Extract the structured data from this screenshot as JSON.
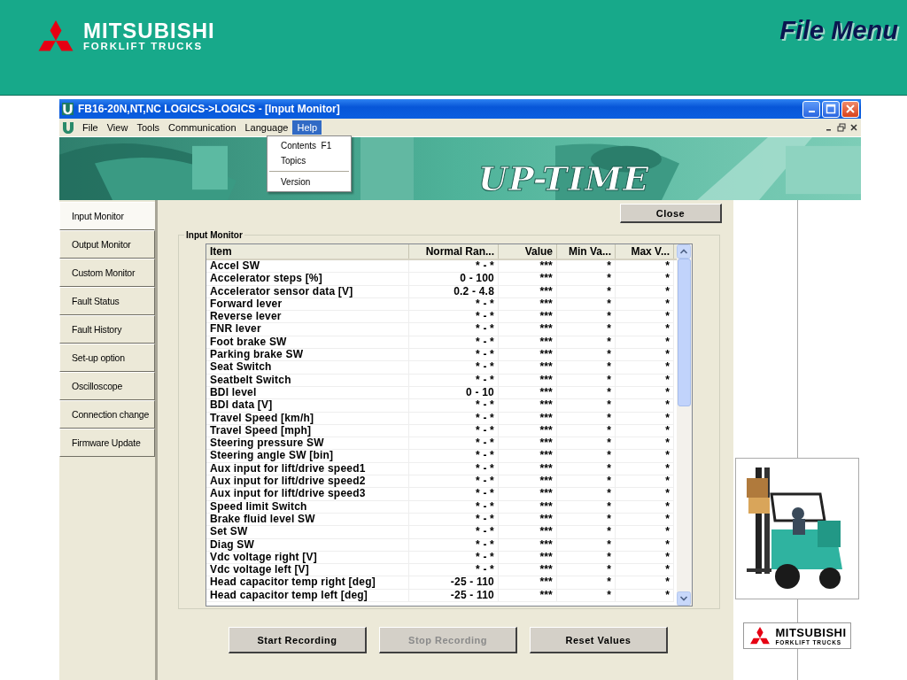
{
  "slide": {
    "logo": {
      "line1": "MITSUBISHI",
      "line2": "FORKLIFT TRUCKS"
    },
    "title": "File Menu"
  },
  "window": {
    "title": "FB16-20N,NT,NC LOGICS->LOGICS - [Input Monitor]"
  },
  "menu": [
    {
      "label": "File",
      "selected": false
    },
    {
      "label": "View",
      "selected": false
    },
    {
      "label": "Tools",
      "selected": false
    },
    {
      "label": "Communication",
      "selected": false
    },
    {
      "label": "Language",
      "selected": false
    },
    {
      "label": "Help",
      "selected": true
    }
  ],
  "help_menu": [
    {
      "kind": "item",
      "label": "Contents",
      "shortcut": "F1"
    },
    {
      "kind": "item",
      "label": "Topics"
    },
    {
      "kind": "separator"
    },
    {
      "kind": "item",
      "label": "Version"
    }
  ],
  "banner": {
    "brand": "UP-TIME"
  },
  "sidebar": {
    "items": [
      {
        "label": "Input Monitor",
        "selected": true
      },
      {
        "label": "Output Monitor",
        "selected": false
      },
      {
        "label": "Custom Monitor",
        "selected": false
      },
      {
        "label": "Fault Status",
        "selected": false
      },
      {
        "label": "Fault History",
        "selected": false
      },
      {
        "label": "Set-up option",
        "selected": false
      },
      {
        "label": "Oscilloscope",
        "selected": false
      },
      {
        "label": "Connection change",
        "selected": false
      },
      {
        "label": "Firmware Update",
        "selected": false
      }
    ]
  },
  "close_button": "Close",
  "group": {
    "title": "Input Monitor"
  },
  "table": {
    "columns": [
      "Item",
      "Normal Ran...",
      "Value",
      "Min Va...",
      "Max V..."
    ],
    "rows": [
      [
        "Accel SW",
        "* - *",
        "***",
        "*",
        "*"
      ],
      [
        "Accelerator steps [%]",
        "0 - 100",
        "***",
        "*",
        "*"
      ],
      [
        "Accelerator sensor data [V]",
        "0.2 - 4.8",
        "***",
        "*",
        "*"
      ],
      [
        "Forward lever",
        "* - *",
        "***",
        "*",
        "*"
      ],
      [
        "Reverse lever",
        "* - *",
        "***",
        "*",
        "*"
      ],
      [
        "FNR lever",
        "* - *",
        "***",
        "*",
        "*"
      ],
      [
        "Foot brake SW",
        "* - *",
        "***",
        "*",
        "*"
      ],
      [
        "Parking brake SW",
        "* - *",
        "***",
        "*",
        "*"
      ],
      [
        "Seat Switch",
        "* - *",
        "***",
        "*",
        "*"
      ],
      [
        "Seatbelt Switch",
        "* - *",
        "***",
        "*",
        "*"
      ],
      [
        "BDI level",
        "0 - 10",
        "***",
        "*",
        "*"
      ],
      [
        "BDI data [V]",
        "* - *",
        "***",
        "*",
        "*"
      ],
      [
        "Travel Speed [km/h]",
        "* - *",
        "***",
        "*",
        "*"
      ],
      [
        "Travel Speed [mph]",
        "* - *",
        "***",
        "*",
        "*"
      ],
      [
        "Steering pressure SW",
        "* - *",
        "***",
        "*",
        "*"
      ],
      [
        "Steering angle SW [bin]",
        "* - *",
        "***",
        "*",
        "*"
      ],
      [
        "Aux input for lift/drive speed1",
        "* - *",
        "***",
        "*",
        "*"
      ],
      [
        "Aux input for lift/drive speed2",
        "* - *",
        "***",
        "*",
        "*"
      ],
      [
        "Aux input for lift/drive speed3",
        "* - *",
        "***",
        "*",
        "*"
      ],
      [
        "Speed limit Switch",
        "* - *",
        "***",
        "*",
        "*"
      ],
      [
        "Brake fluid level SW",
        "* - *",
        "***",
        "*",
        "*"
      ],
      [
        "Set SW",
        "* - *",
        "***",
        "*",
        "*"
      ],
      [
        "Diag SW",
        "* - *",
        "***",
        "*",
        "*"
      ],
      [
        "Vdc voltage right [V]",
        "* - *",
        "***",
        "*",
        "*"
      ],
      [
        "Vdc voltage left [V]",
        "* - *",
        "***",
        "*",
        "*"
      ],
      [
        "Head capacitor temp right [deg]",
        "-25 - 110",
        "***",
        "*",
        "*"
      ],
      [
        "Head capacitor temp left [deg]",
        "-25 - 110",
        "***",
        "*",
        "*"
      ]
    ]
  },
  "buttons": [
    {
      "label": "Start Recording",
      "disabled": false
    },
    {
      "label": "Stop Recording",
      "disabled": true
    },
    {
      "label": "Reset Values",
      "disabled": false
    }
  ],
  "side_logo": {
    "line1": "MITSUBISHI",
    "line2": "FORKLIFT TRUCKS"
  }
}
